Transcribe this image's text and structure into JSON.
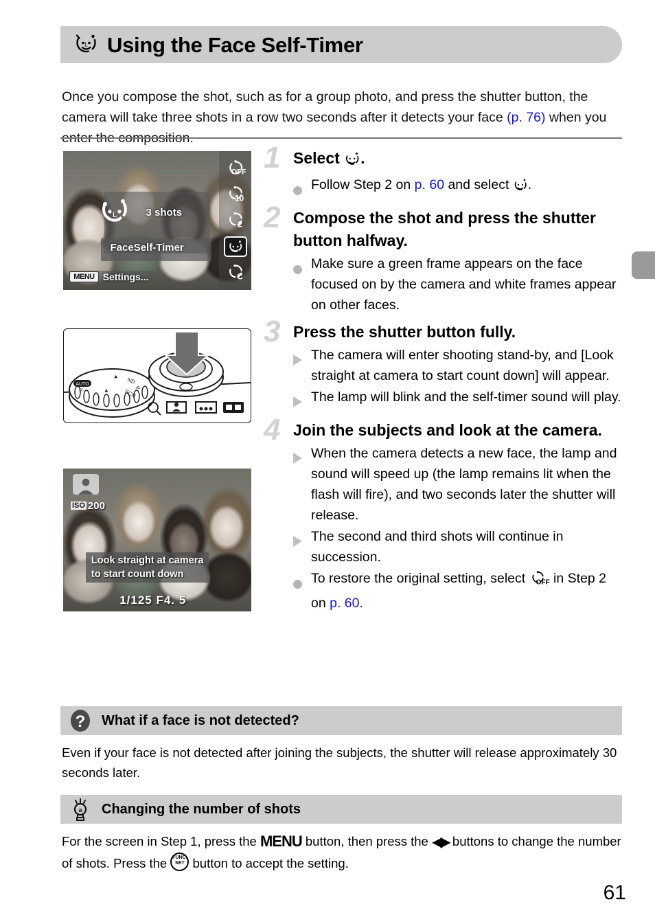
{
  "header": {
    "icon": "face-self-timer-icon",
    "title": "Using the Face Self-Timer"
  },
  "intro": {
    "text_before": "Once you compose the shot, such as for a group photo, and press the shutter button, the camera will take three shots in a row two seconds after it detects your face ",
    "page_ref": "(p. 76)",
    "text_after": " when you enter the composition."
  },
  "figures": {
    "fig1": {
      "name": "self-timer-menu-screen",
      "shots_label": "3  shots",
      "mode_label": "FaceSelf-Timer",
      "menu_chip": "MENU",
      "menu_chip_label": "Settings...",
      "rail_items": [
        {
          "name": "self-timer-off-icon",
          "label": "OFF",
          "selected": false
        },
        {
          "name": "self-timer-10s-icon",
          "label": "10",
          "selected": false
        },
        {
          "name": "self-timer-2s-icon",
          "label": "2",
          "selected": false
        },
        {
          "name": "face-self-timer-icon",
          "label": "",
          "selected": true
        },
        {
          "name": "custom-self-timer-icon",
          "label": "C",
          "selected": false
        }
      ]
    },
    "fig2": {
      "name": "shutter-button-diagram",
      "caption": ""
    },
    "fig3": {
      "name": "shooting-standby-screen",
      "iso_prefix": "ISO",
      "iso_value": "200",
      "message": "Look straight at camera\nto start count down",
      "exposure": "1/125   F4. 5"
    }
  },
  "steps": [
    {
      "number": "1",
      "title_text": "Select ",
      "title_icon": "face-self-timer-icon",
      "title_suffix": ".",
      "bullets": [
        {
          "marker": "dot",
          "pre": "Follow Step 2 on ",
          "link": "p. 60",
          "post": " and select ",
          "icon": "face-self-timer-icon",
          "tail": "."
        }
      ]
    },
    {
      "number": "2",
      "title_text": "Compose the shot and press the shutter button halfway.",
      "bullets": [
        {
          "marker": "dot",
          "pre": "Make sure a green frame appears on the face focused on by the camera and white frames appear on other faces.",
          "link": "",
          "post": "",
          "tail": ""
        }
      ]
    },
    {
      "number": "3",
      "title_text": "Press the shutter button fully.",
      "bullets": [
        {
          "marker": "triangle",
          "pre": "The camera will enter shooting stand-by, and [Look straight at camera to start count down] will appear.",
          "link": "",
          "post": "",
          "tail": ""
        },
        {
          "marker": "triangle",
          "pre": "The lamp will blink and the self-timer sound will play.",
          "link": "",
          "post": "",
          "tail": ""
        }
      ]
    },
    {
      "number": "4",
      "title_text": "Join the subjects and look at the camera.",
      "bullets": [
        {
          "marker": "triangle",
          "pre": "When the camera detects a new face, the lamp and sound will speed up (the lamp remains lit when the flash will fire), and two seconds later the shutter will release.",
          "link": "",
          "post": "",
          "tail": ""
        },
        {
          "marker": "triangle",
          "pre": "The second and third shots will continue in succession.",
          "link": "",
          "post": "",
          "tail": ""
        },
        {
          "marker": "dot",
          "pre": "To restore the original setting, select ",
          "icon": "self-timer-off-icon",
          "post": " in Step 2 on ",
          "link": "p. 60",
          "tail": "."
        }
      ]
    }
  ],
  "notes": [
    {
      "icon": "question-mark-icon",
      "title": "What if a face is not detected?",
      "body": "Even if your face is not detected after joining the subjects, the shutter will release approximately 30 seconds later."
    },
    {
      "icon": "lightbulb-icon",
      "title": "Changing the number of shots",
      "body_part1": "For the screen in Step 1, press the ",
      "body_menu": "MENU",
      "body_part2": " button, then press the ",
      "body_lr": "◀▶",
      "body_part3": " buttons to change the number of shots. Press the ",
      "body_func1": "FUNC.",
      "body_func2": "SET",
      "body_part4": " button to accept the setting."
    }
  ],
  "page_number": "61",
  "colors": {
    "banner_gray": "#cccccc",
    "link_blue": "#1313e0",
    "step_number_gray": "#d2d2d2",
    "divider_gray": "#767676",
    "edge_tab_gray": "#9a9a9a"
  }
}
